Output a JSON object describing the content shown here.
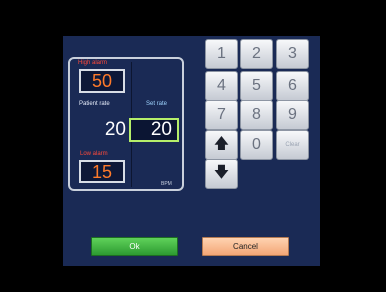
{
  "alarm_panel": {
    "high_alarm_label": "High alarm",
    "high_alarm_value": "50",
    "patient_rate_label": "Patient rate",
    "patient_rate_value": "20",
    "set_rate_label": "Set rate",
    "set_rate_value": "20",
    "low_alarm_label": "Low alarm",
    "low_alarm_value": "15",
    "unit_label": "BPM"
  },
  "keypad": {
    "keys": [
      "1",
      "2",
      "3",
      "4",
      "5",
      "6",
      "7",
      "8",
      "9",
      "0",
      "Clear"
    ],
    "up_icon": "up-arrow-icon",
    "down_icon": "down-arrow-icon"
  },
  "actions": {
    "ok_label": "Ok",
    "cancel_label": "Cancel"
  },
  "colors": {
    "screen_background": "#1a2a55",
    "alarm_value": "#ff7a2a",
    "alarm_label": "#ff4a3a",
    "set_rate_border": "#b6ef6a",
    "ok_button": "#3fb444",
    "cancel_button": "#f7b98c"
  }
}
